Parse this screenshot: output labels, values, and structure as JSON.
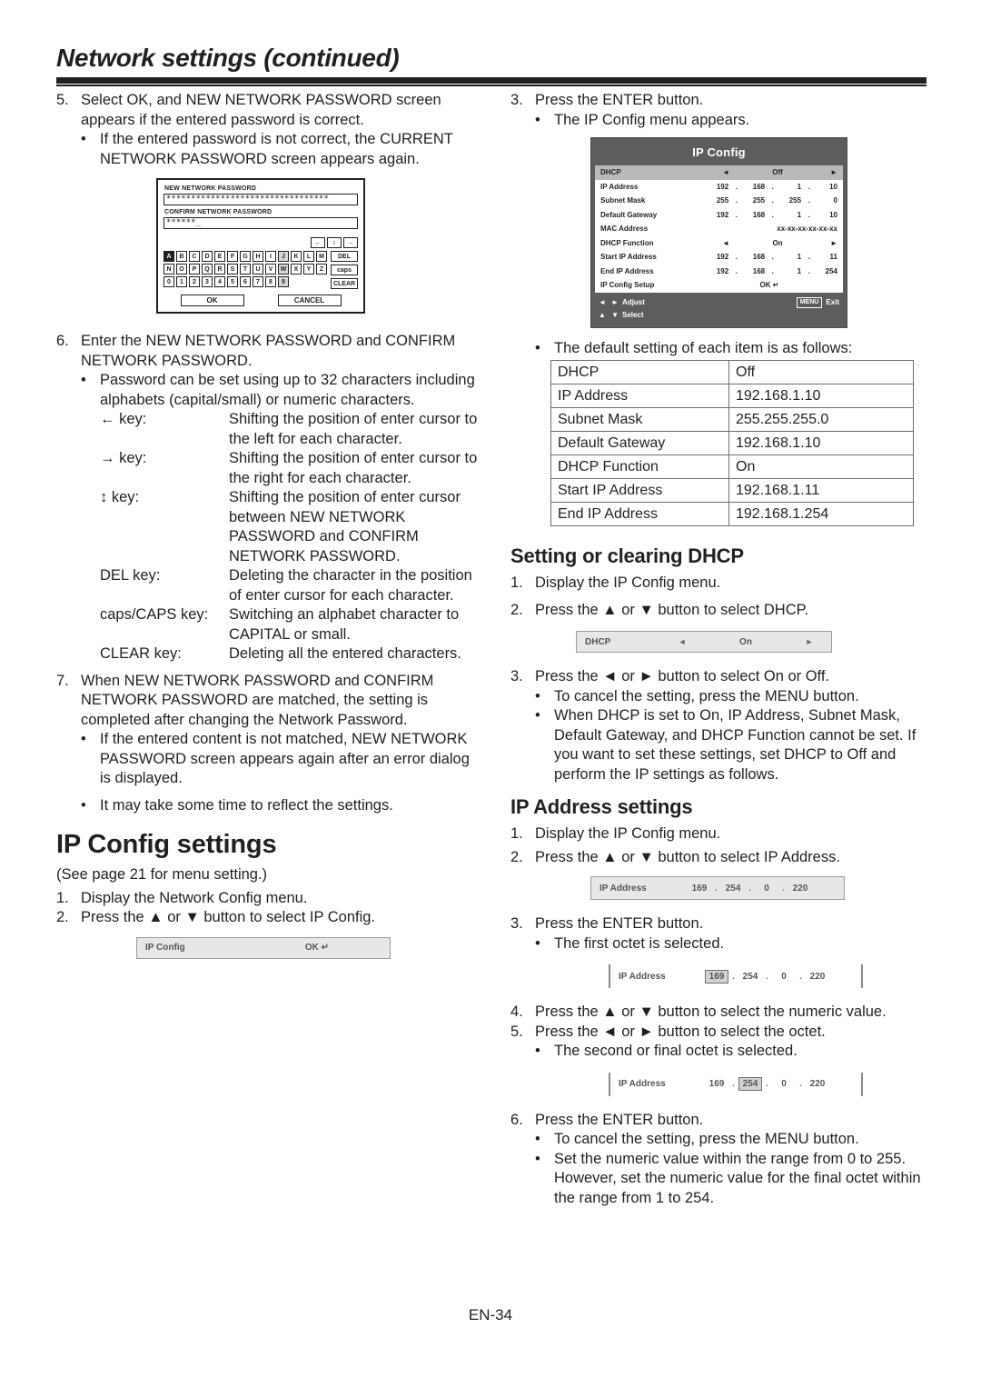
{
  "header": {
    "title": "Network settings (continued)"
  },
  "footer": {
    "page_label": "EN-34"
  },
  "left": {
    "step5": {
      "num": "5.",
      "text": "Select OK, and NEW NETWORK PASSWORD screen appears if the entered password is correct.",
      "bullet": "If the entered password is not correct, the CURRENT NETWORK PASSWORD screen appears again."
    },
    "password_dialog": {
      "new_label": "NEW NETWORK PASSWORD",
      "new_value": "*********************************",
      "confirm_label": "CONFIRM NETWORK PASSWORD",
      "confirm_value": "******_",
      "nav_keys": [
        "←",
        "↕",
        "→"
      ],
      "row1": [
        "A",
        "B",
        "C",
        "D",
        "E",
        "F",
        "G",
        "H",
        "I",
        "J",
        "K",
        "L",
        "M"
      ],
      "row2": [
        "N",
        "O",
        "P",
        "Q",
        "R",
        "S",
        "T",
        "U",
        "V",
        "W",
        "X",
        "Y",
        "Z"
      ],
      "row3": [
        "0",
        "1",
        "2",
        "3",
        "4",
        "5",
        "6",
        "7",
        "8",
        "9"
      ],
      "selected_key": "A",
      "side_buttons": [
        "DEL",
        "caps",
        "CLEAR"
      ],
      "ok_label": "OK",
      "cancel_label": "CANCEL"
    },
    "step6": {
      "num": "6.",
      "text": "Enter the NEW NETWORK PASSWORD and CONFIRM NETWORK PASSWORD.",
      "bullet": "Password can be set using up to 32 characters including alphabets (capital/small) or numeric characters."
    },
    "key_help": [
      {
        "name": "← key:",
        "desc": "Shifting the position of enter cursor to the left for each character."
      },
      {
        "name": "→ key:",
        "desc": "Shifting the position of enter cursor to the right for each character."
      },
      {
        "name": "↕ key:",
        "desc": "Shifting the position of enter cursor between NEW NETWORK PASSWORD and CONFIRM NETWORK PASSWORD."
      },
      {
        "name": "DEL key:",
        "desc": "Deleting the character in the position of enter cursor for each character."
      },
      {
        "name": "caps/CAPS key:",
        "desc": "Switching an alphabet character to CAPITAL or small."
      },
      {
        "name": "CLEAR key:",
        "desc": "Deleting all the entered characters."
      }
    ],
    "step7": {
      "num": "7.",
      "text": "When NEW NETWORK PASSWORD and CONFIRM NETWORK PASSWORD are matched, the setting is completed after changing the Network Password.",
      "bullet1": "If the entered content is not matched, NEW NETWORK PASSWORD screen appears again after an error dialog is displayed.",
      "bullet2": "It may take some time to reflect the settings."
    },
    "ipconfig_settings": {
      "heading": "IP Config settings",
      "note": "(See page 21 for menu setting.)",
      "step1_num": "1.",
      "step1": "Display the Network Config menu.",
      "step2_num": "2.",
      "step2": "Press the ▲ or ▼ button to select IP Config."
    },
    "ipconfig_bar": {
      "label": "IP Config",
      "value": "OK ↵"
    }
  },
  "right": {
    "step3": {
      "num": "3.",
      "text": "Press the ENTER button.",
      "bullet": "The IP Config menu appears."
    },
    "osd": {
      "title": "IP Config",
      "rows": [
        {
          "label": "DHCP",
          "type": "adjust",
          "value": "Off",
          "left_arrow": "◄",
          "right_arrow": "►",
          "highlight": true
        },
        {
          "label": "IP Address",
          "type": "octets",
          "octets": [
            "192",
            "168",
            "1",
            "10"
          ]
        },
        {
          "label": "Subnet Mask",
          "type": "octets",
          "octets": [
            "255",
            "255",
            "255",
            "0"
          ]
        },
        {
          "label": "Default Gateway",
          "type": "octets",
          "octets": [
            "192",
            "168",
            "1",
            "10"
          ]
        },
        {
          "label": "MAC Address",
          "type": "text",
          "value": "xx-xx-xx-xx-xx-xx"
        },
        {
          "label": "DHCP Function",
          "type": "adjust",
          "value": "On",
          "left_arrow": "◄",
          "right_arrow": "►"
        },
        {
          "label": "Start IP Address",
          "type": "octets",
          "octets": [
            "192",
            "168",
            "1",
            "11"
          ]
        },
        {
          "label": "End IP Address",
          "type": "octets",
          "octets": [
            "192",
            "168",
            "1",
            "254"
          ]
        },
        {
          "label": "IP Config Setup",
          "type": "center",
          "value": "OK ↵"
        }
      ],
      "footer": {
        "adjust_icons": "◄ ►",
        "adjust_label": "Adjust",
        "select_icons": "▲ ▼",
        "select_label": "Select",
        "menu_chip": "MENU",
        "exit_label": "Exit"
      }
    },
    "defaults": {
      "intro": "The default setting of each item is as follows:",
      "rows": [
        {
          "key": "DHCP",
          "value": "Off"
        },
        {
          "key": "IP Address",
          "value": "192.168.1.10"
        },
        {
          "key": "Subnet Mask",
          "value": "255.255.255.0"
        },
        {
          "key": "Default Gateway",
          "value": "192.168.1.10"
        },
        {
          "key": "DHCP Function",
          "value": "On"
        },
        {
          "key": "Start IP Address",
          "value": "192.168.1.11"
        },
        {
          "key": "End IP Address",
          "value": "192.168.1.254"
        }
      ]
    },
    "dhcp_section": {
      "heading": "Setting or clearing DHCP",
      "step1_num": "1.",
      "step1": "Display the IP Config menu.",
      "step2_num": "2.",
      "step2": "Press the ▲ or ▼ button to select DHCP.",
      "widget": {
        "label": "DHCP",
        "value": "On",
        "left_arrow": "◄",
        "right_arrow": "►"
      },
      "step3_num": "3.",
      "step3": "Press the ◄ or ► button to select On or Off.",
      "bullet1": "To cancel the setting, press the MENU button.",
      "bullet2": "When DHCP is set to On, IP Address, Subnet Mask, Default Gateway, and DHCP Function cannot be set. If you want to set these settings, set DHCP to Off and perform the IP settings as follows."
    },
    "ip_section": {
      "heading": "IP Address settings",
      "step1_num": "1.",
      "step1": "Display the IP Config menu.",
      "step2_num": "2.",
      "step2": "Press the ▲ or ▼ button to select IP Address.",
      "widget1": {
        "label": "IP Address",
        "octets": [
          "169",
          "254",
          "0",
          "220"
        ],
        "selected": -1
      },
      "step3_num": "3.",
      "step3": "Press the ENTER button.",
      "step3_bullet": "The first octet is selected.",
      "widget2": {
        "label": "IP Address",
        "octets": [
          "169",
          "254",
          "0",
          "220"
        ],
        "selected": 0
      },
      "step4_num": "4.",
      "step4": "Press the ▲ or ▼ button to select the numeric value.",
      "step5_num": "5.",
      "step5": "Press the ◄ or ► button to select the octet.",
      "step5_bullet": "The second or final octet is selected.",
      "widget3": {
        "label": "IP Address",
        "octets": [
          "169",
          "254",
          "0",
          "220"
        ],
        "selected": 1
      },
      "step6_num": "6.",
      "step6": "Press the ENTER button.",
      "step6_bullet1": "To cancel the setting, press the MENU button.",
      "step6_bullet2": "Set the numeric value within the range from 0 to 255. However, set the numeric value for the final octet within the range from 1 to 254."
    }
  }
}
